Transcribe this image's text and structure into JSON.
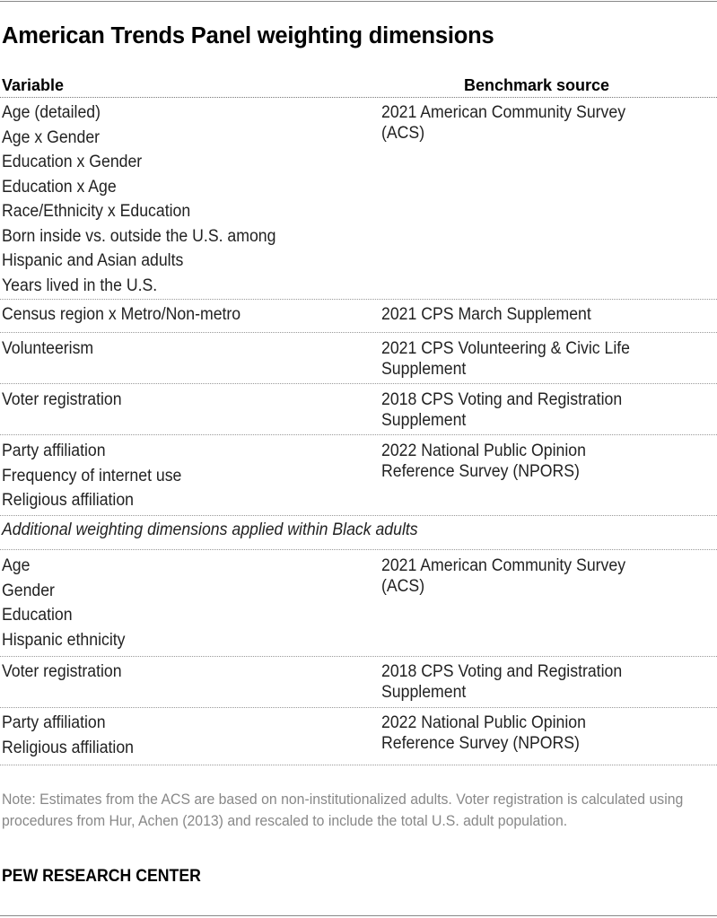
{
  "title": "American Trends Panel weighting dimensions",
  "headers": {
    "variable": "Variable",
    "source": "Benchmark source"
  },
  "groups": [
    {
      "variables": [
        "Age (detailed)",
        "Age x Gender",
        "Education x Gender",
        "Education x Age",
        "Race/Ethnicity x Education",
        "Born inside vs. outside the U.S. among",
        "Hispanic and Asian adults",
        "Years lived in the U.S."
      ],
      "source": [
        "2021 American Community Survey",
        "(ACS)"
      ]
    },
    {
      "variables": [
        "Census region x Metro/Non-metro"
      ],
      "source": [
        "2021 CPS March Supplement"
      ]
    },
    {
      "variables": [
        "Volunteerism"
      ],
      "source": [
        "2021 CPS Volunteering & Civic Life",
        "Supplement"
      ]
    },
    {
      "variables": [
        "Voter registration"
      ],
      "source": [
        "2018 CPS Voting and Registration",
        "Supplement"
      ]
    },
    {
      "variables": [
        "Party affiliation",
        "Frequency of internet use",
        "Religious affiliation"
      ],
      "source": [
        "2022 National Public Opinion",
        "Reference Survey (NPORS)"
      ]
    }
  ],
  "subheading": "Additional weighting dimensions applied within Black adults",
  "groups2": [
    {
      "variables": [
        "Age",
        "Gender",
        "Education",
        "Hispanic ethnicity"
      ],
      "source": [
        "2021 American Community Survey",
        "(ACS)"
      ]
    },
    {
      "variables": [
        "Voter registration"
      ],
      "source": [
        "2018 CPS Voting and Registration",
        "Supplement"
      ]
    },
    {
      "variables": [
        "Party affiliation",
        "Religious affiliation"
      ],
      "source": [
        "2022 National Public Opinion",
        "Reference Survey (NPORS)"
      ]
    }
  ],
  "note": "Note: Estimates from the ACS are based on non-institutionalized adults. Voter registration is calculated using procedures from Hur, Achen (2013) and rescaled to include the total U.S. adult population.",
  "brand": "PEW RESEARCH CENTER"
}
